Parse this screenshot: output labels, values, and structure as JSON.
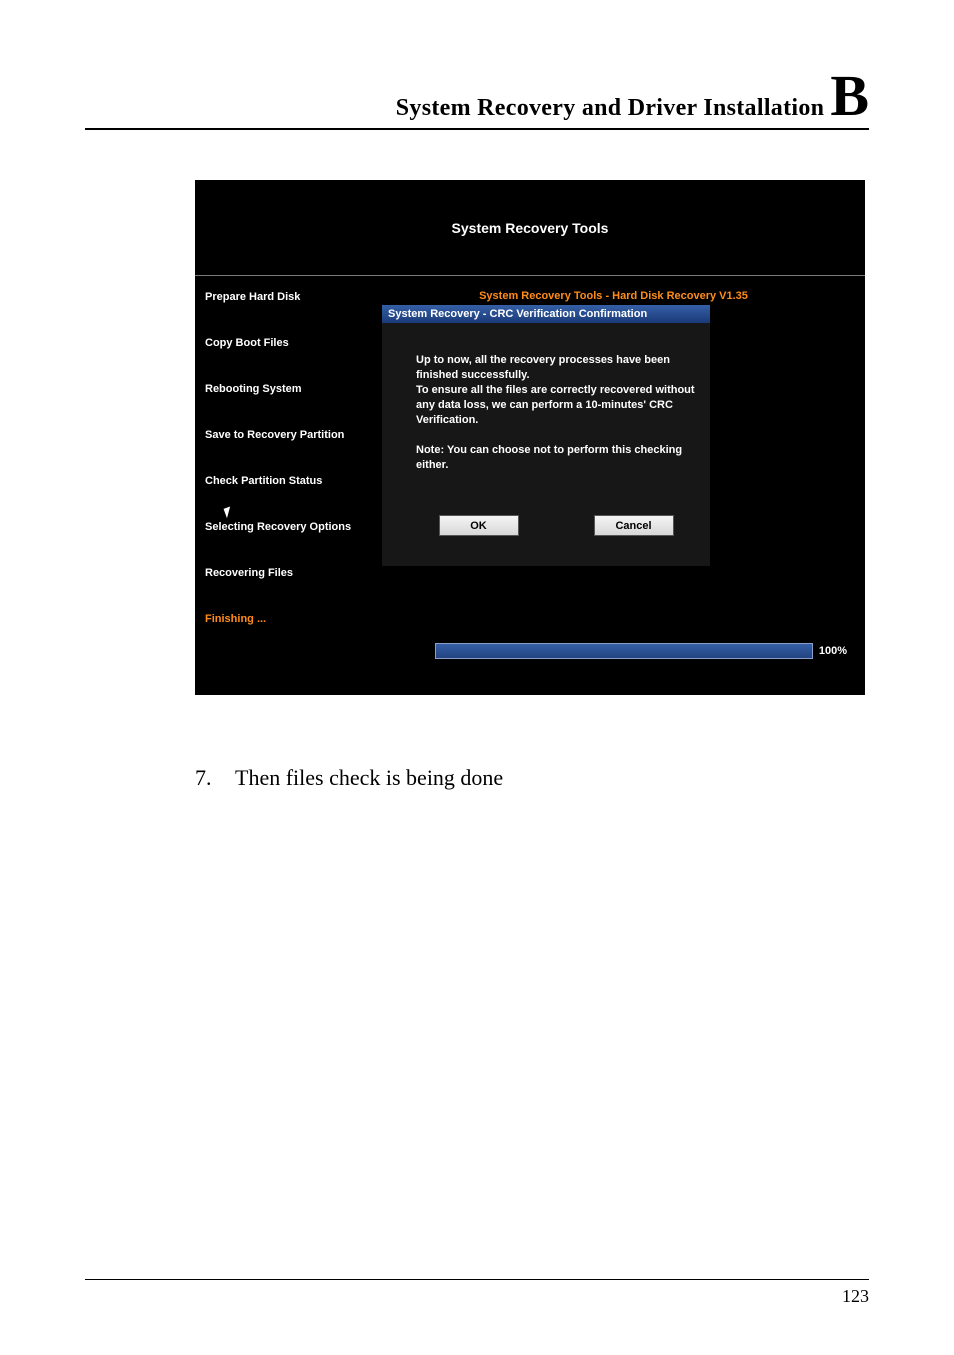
{
  "header": {
    "title": "System Recovery and Driver Installation",
    "appendix_letter": "B"
  },
  "screenshot": {
    "title": "System Recovery Tools",
    "subtitle": "System Recovery Tools - Hard Disk Recovery V1.35",
    "steps": {
      "s1": "Prepare Hard Disk",
      "s2": "Copy Boot Files",
      "s3": "Rebooting System",
      "s4": "Save to Recovery Partition",
      "s5": "Check Partition Status",
      "s6": "Selecting Recovery Options",
      "s7": "Recovering Files",
      "s8": "Finishing ..."
    },
    "dialog": {
      "title": "System Recovery - CRC Verification Confirmation",
      "para1": "Up to now, all the recovery processes have been finished successfully.\nTo ensure all the files are correctly recovered without any data loss, we can perform a 10-minutes' CRC Verification.",
      "para2": "Note: You can choose not to perform this checking either.",
      "ok": "OK",
      "cancel": "Cancel"
    },
    "progress": "100%"
  },
  "instruction": {
    "number": "7.",
    "text": "Then files check is being done"
  },
  "page_number": "123"
}
